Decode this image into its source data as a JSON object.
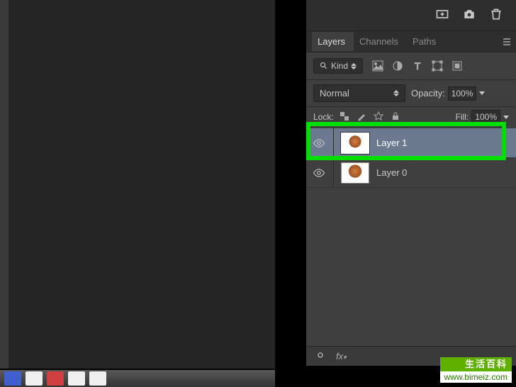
{
  "tabs": {
    "layers": "Layers",
    "channels": "Channels",
    "paths": "Paths"
  },
  "filter": {
    "kind_label": "Kind"
  },
  "blend": {
    "mode": "Normal",
    "opacity_label": "Opacity:",
    "opacity_value": "100%"
  },
  "lock": {
    "label": "Lock:",
    "fill_label": "Fill:",
    "fill_value": "100%"
  },
  "layers": [
    {
      "name": "Layer 1",
      "selected": true
    },
    {
      "name": "Layer 0",
      "selected": false
    }
  ],
  "watermark": {
    "top": "生活百科",
    "url": "www.bimeiz.com"
  }
}
